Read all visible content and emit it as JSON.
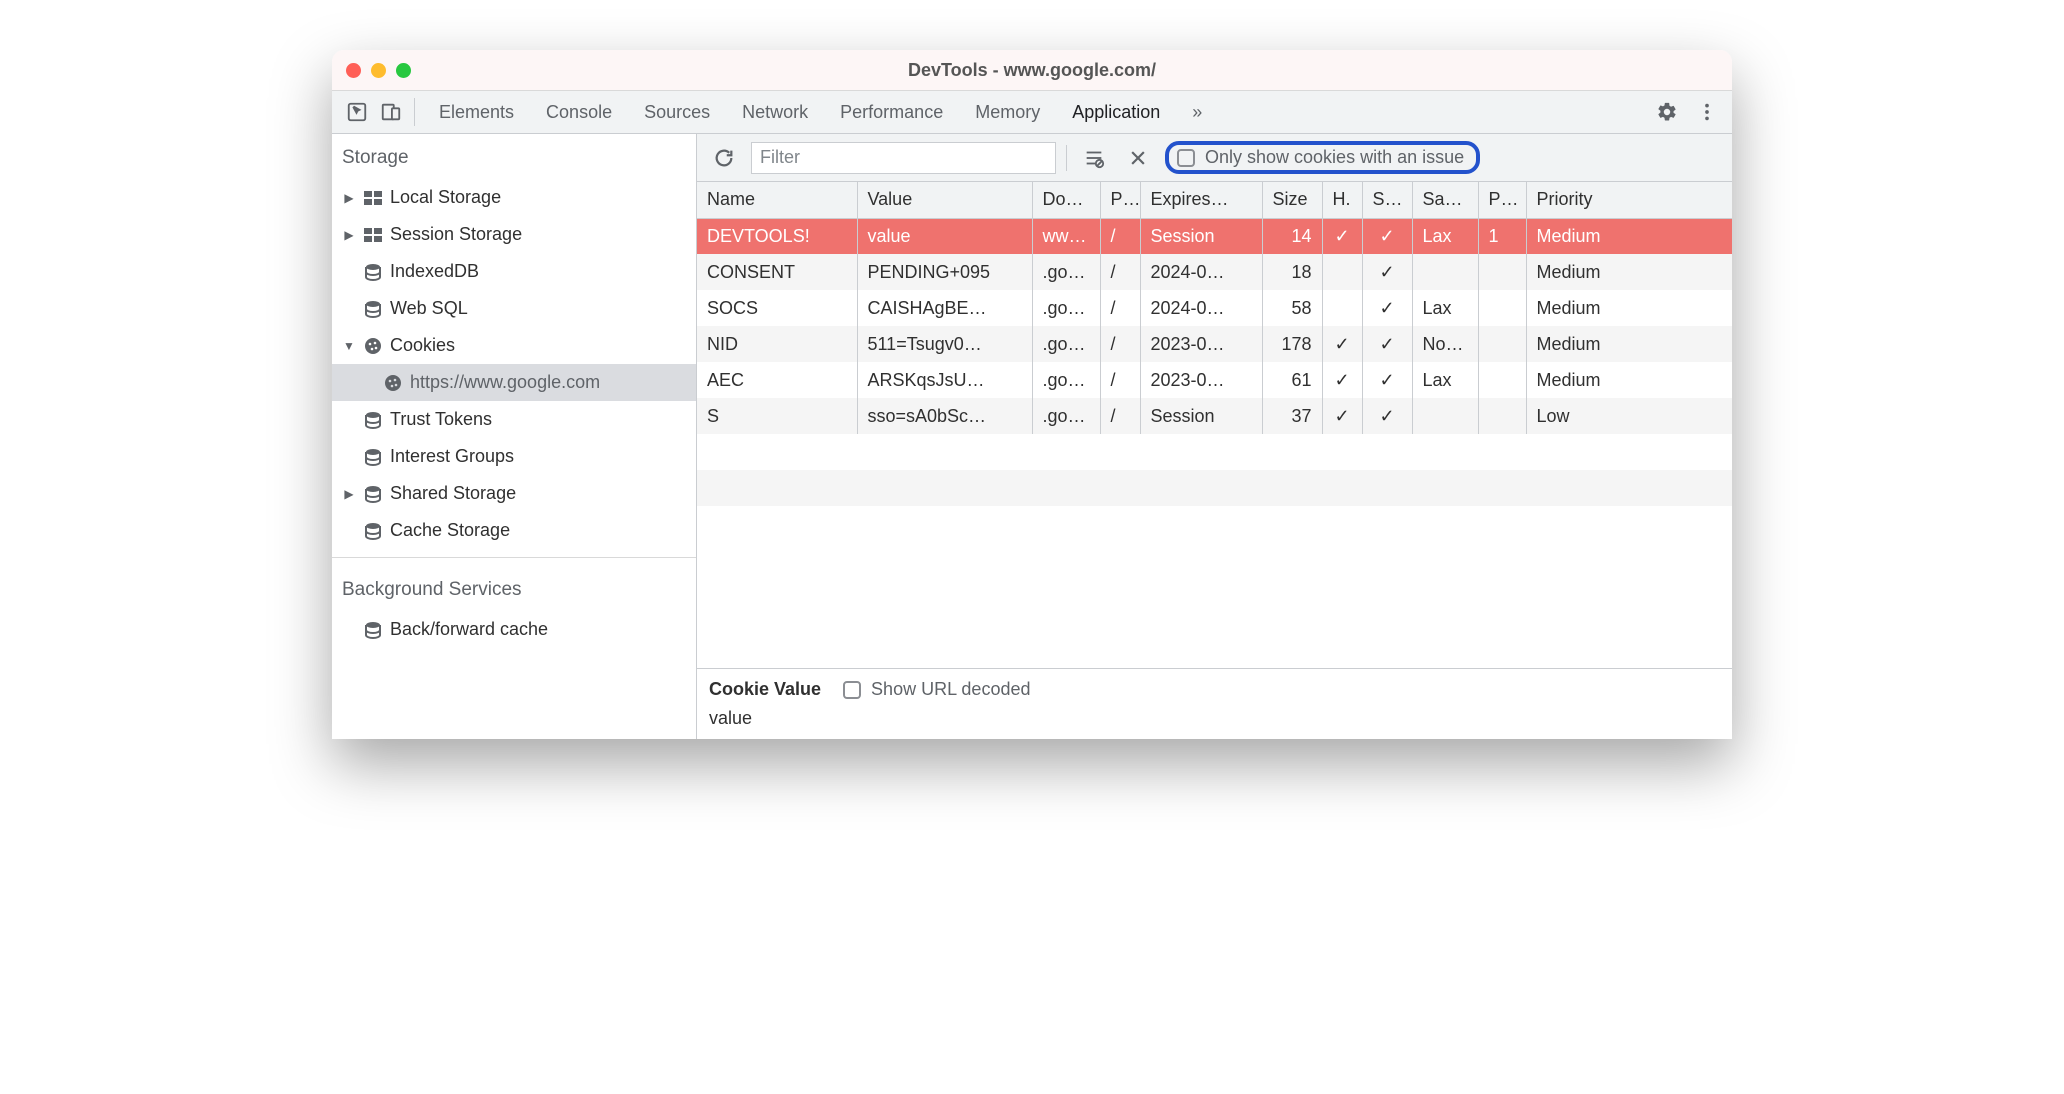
{
  "window": {
    "title": "DevTools - www.google.com/"
  },
  "tabs": [
    "Elements",
    "Console",
    "Sources",
    "Network",
    "Performance",
    "Memory",
    "Application"
  ],
  "active_tab": "Application",
  "sidebar": {
    "storage_title": "Storage",
    "items": [
      {
        "label": "Local Storage",
        "icon": "table",
        "expandable": true
      },
      {
        "label": "Session Storage",
        "icon": "table",
        "expandable": true
      },
      {
        "label": "IndexedDB",
        "icon": "db"
      },
      {
        "label": "Web SQL",
        "icon": "db"
      },
      {
        "label": "Cookies",
        "icon": "cookie",
        "expanded": true,
        "children": [
          {
            "label": "https://www.google.com",
            "icon": "cookie",
            "selected": true
          }
        ]
      },
      {
        "label": "Trust Tokens",
        "icon": "db"
      },
      {
        "label": "Interest Groups",
        "icon": "db"
      },
      {
        "label": "Shared Storage",
        "icon": "db",
        "expandable": true
      },
      {
        "label": "Cache Storage",
        "icon": "db"
      }
    ],
    "bg_title": "Background Services",
    "bg_items": [
      {
        "label": "Back/forward cache",
        "icon": "db"
      }
    ]
  },
  "toolbar": {
    "filter_placeholder": "Filter",
    "only_issues_label": "Only show cookies with an issue"
  },
  "columns": [
    "Name",
    "Value",
    "Do…",
    "P…",
    "Expires…",
    "Size",
    "H.",
    "S…",
    "Sa…",
    "P…",
    "Priority"
  ],
  "rows": [
    {
      "sel": true,
      "name": "DEVTOOLS!",
      "value": "value",
      "domain": "ww…",
      "path": "/",
      "expires": "Session",
      "size": "14",
      "http": "✓",
      "secure": "✓",
      "samesite": "Lax",
      "partition": "1",
      "priority": "Medium"
    },
    {
      "sel": false,
      "name": "CONSENT",
      "value": "PENDING+095",
      "domain": ".go…",
      "path": "/",
      "expires": "2024-0…",
      "size": "18",
      "http": "",
      "secure": "✓",
      "samesite": "",
      "partition": "",
      "priority": "Medium"
    },
    {
      "sel": false,
      "name": "SOCS",
      "value": "CAISHAgBE…",
      "domain": ".go…",
      "path": "/",
      "expires": "2024-0…",
      "size": "58",
      "http": "",
      "secure": "✓",
      "samesite": "Lax",
      "partition": "",
      "priority": "Medium"
    },
    {
      "sel": false,
      "name": "NID",
      "value": "511=Tsugv0…",
      "domain": ".go…",
      "path": "/",
      "expires": "2023-0…",
      "size": "178",
      "http": "✓",
      "secure": "✓",
      "samesite": "No…",
      "partition": "",
      "priority": "Medium"
    },
    {
      "sel": false,
      "name": "AEC",
      "value": "ARSKqsJsU…",
      "domain": ".go…",
      "path": "/",
      "expires": "2023-0…",
      "size": "61",
      "http": "✓",
      "secure": "✓",
      "samesite": "Lax",
      "partition": "",
      "priority": "Medium"
    },
    {
      "sel": false,
      "name": "S",
      "value": "sso=sA0bSc…",
      "domain": ".go…",
      "path": "/",
      "expires": "Session",
      "size": "37",
      "http": "✓",
      "secure": "✓",
      "samesite": "",
      "partition": "",
      "priority": "Low"
    }
  ],
  "detail": {
    "label": "Cookie Value",
    "url_decoded_label": "Show URL decoded",
    "value": "value"
  }
}
